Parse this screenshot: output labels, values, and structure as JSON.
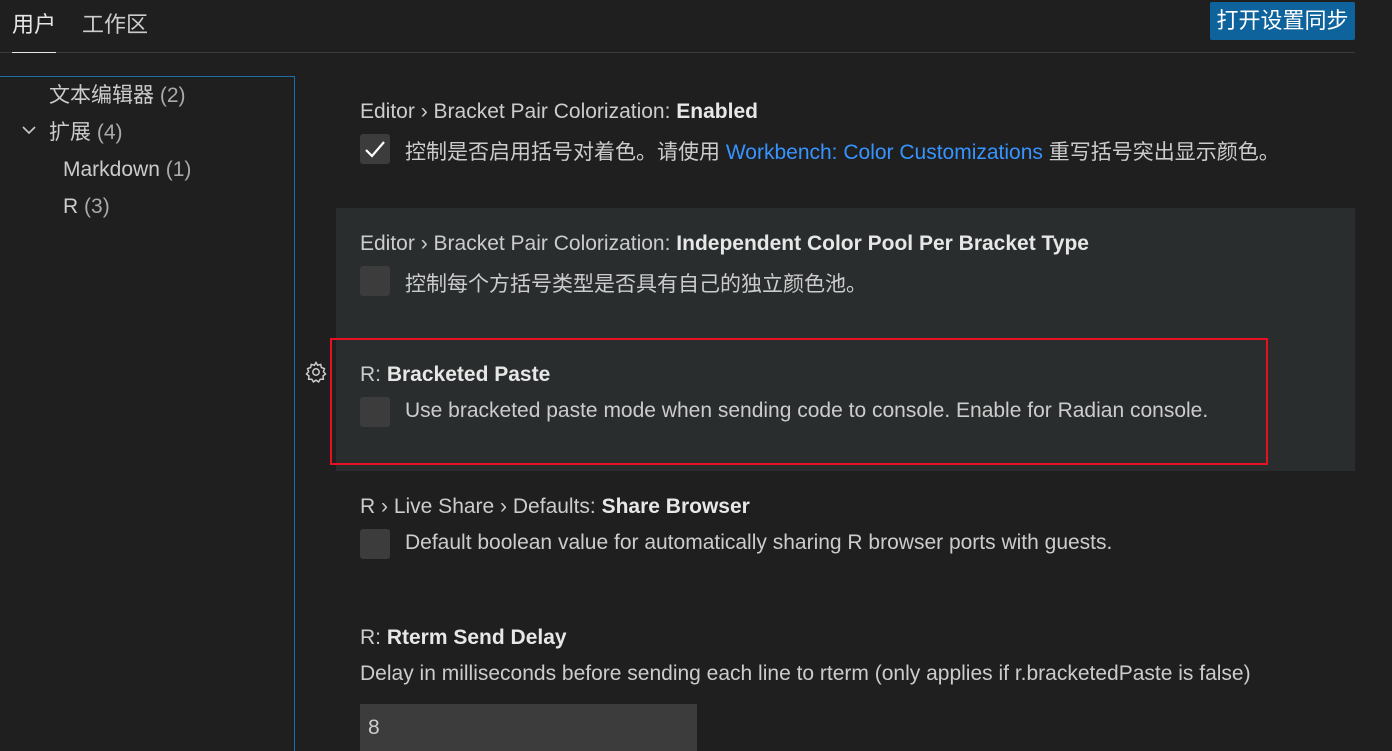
{
  "tabs": {
    "user": "用户",
    "workspace": "工作区"
  },
  "sync_button": "打开设置同步",
  "toc": {
    "items": [
      {
        "label": "文本编辑器",
        "count": "(2)"
      },
      {
        "label": "扩展",
        "count": "(4)"
      },
      {
        "label": "Markdown",
        "count": "(1)"
      },
      {
        "label": "R",
        "count": "(3)"
      }
    ]
  },
  "settings": [
    {
      "category": "Editor › Bracket Pair Colorization: ",
      "name": "Enabled",
      "desc_before": "控制是否启用括号对着色。请使用 ",
      "link": "Workbench: Color Customizations",
      "desc_after": " 重写括号突出显示颜色。",
      "checked": true
    },
    {
      "category": "Editor › Bracket Pair Colorization: ",
      "name": "Independent Color Pool Per Bracket Type",
      "desc": "控制每个方括号类型是否具有自己的独立颜色池。",
      "checked": false
    },
    {
      "category": "R: ",
      "name": "Bracketed Paste",
      "desc": "Use bracketed paste mode when sending code to console. Enable for Radian console.",
      "checked": false
    },
    {
      "category": "R › Live Share › Defaults: ",
      "name": "Share Browser",
      "desc": "Default boolean value for automatically sharing R browser ports with guests.",
      "checked": false
    },
    {
      "category": "R: ",
      "name": "Rterm Send Delay",
      "desc": "Delay in milliseconds before sending each line to rterm (only applies if r.bracketedPaste is false)",
      "value": "8"
    }
  ],
  "colors": {
    "background": "#1f1f1f",
    "accent_button": "#0e639c",
    "link": "#3794ff",
    "highlight_box": "#e81123",
    "hover_row": "#2a2d2e"
  }
}
